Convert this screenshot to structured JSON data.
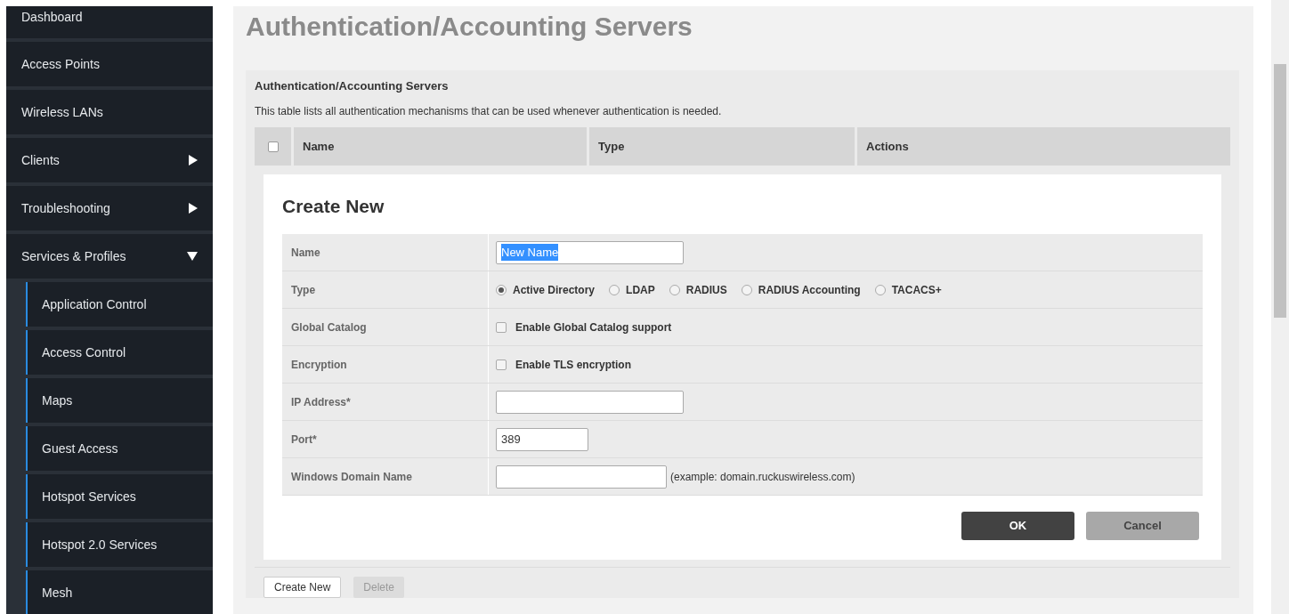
{
  "sidebar": {
    "items": [
      {
        "label": "Dashboard"
      },
      {
        "label": "Access Points"
      },
      {
        "label": "Wireless LANs"
      },
      {
        "label": "Clients",
        "expanded": false
      },
      {
        "label": "Troubleshooting",
        "expanded": false
      },
      {
        "label": "Services & Profiles",
        "expanded": true,
        "children": [
          {
            "label": "Application Control"
          },
          {
            "label": "Access Control"
          },
          {
            "label": "Maps"
          },
          {
            "label": "Guest Access"
          },
          {
            "label": "Hotspot Services"
          },
          {
            "label": "Hotspot 2.0 Services"
          },
          {
            "label": "Mesh"
          }
        ]
      }
    ]
  },
  "page_title": "Authentication/Accounting Servers",
  "panel": {
    "title": "Authentication/Accounting Servers",
    "description": "This table lists all authentication mechanisms that can be used whenever authentication is needed.",
    "table": {
      "select_all_checked": false,
      "columns": [
        "Name",
        "Type",
        "Actions"
      ]
    },
    "dialog": {
      "title": "Create New",
      "fields": [
        {
          "kind": "text",
          "label": "Name",
          "value": "New Name",
          "value_selected": true
        },
        {
          "kind": "radio",
          "label": "Type",
          "options": [
            {
              "label": "Active Directory",
              "selected": true
            },
            {
              "label": "LDAP",
              "selected": false
            },
            {
              "label": "RADIUS",
              "selected": false
            },
            {
              "label": "RADIUS Accounting",
              "selected": false
            },
            {
              "label": "TACACS+",
              "selected": false
            }
          ]
        },
        {
          "kind": "checkbox",
          "label": "Global Catalog",
          "option": "Enable Global Catalog support",
          "checked": false
        },
        {
          "kind": "checkbox",
          "label": "Encryption",
          "option": "Enable TLS encryption",
          "checked": false
        },
        {
          "kind": "text",
          "label": "IP Address*"
        },
        {
          "kind": "text",
          "label": "Port*",
          "value": "389"
        },
        {
          "kind": "text",
          "label": "Windows Domain Name",
          "hint": "(example: domain.ruckuswireless.com)"
        }
      ],
      "buttons": [
        {
          "label": "OK",
          "kind": "primary"
        },
        {
          "label": "Cancel",
          "kind": "secondary"
        }
      ]
    },
    "footer_buttons": [
      {
        "label": "Create New",
        "disabled": false
      },
      {
        "label": "Delete",
        "disabled": true
      }
    ]
  }
}
